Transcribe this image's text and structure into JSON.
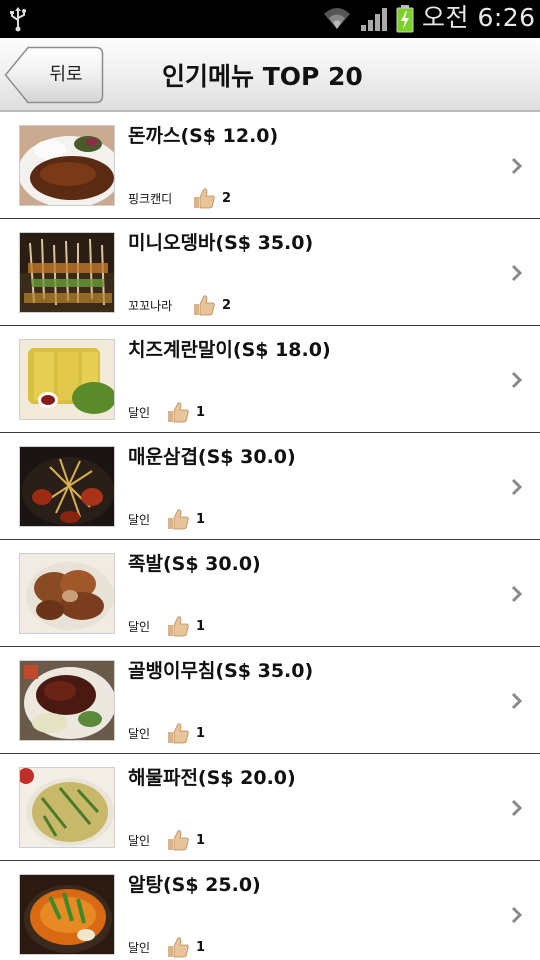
{
  "status_bar": {
    "time": "오전 6:26",
    "icons": [
      "usb-icon",
      "wifi-icon",
      "signal-icon",
      "battery-charging-icon"
    ]
  },
  "header": {
    "back_label": "뒤로",
    "title": "인기메뉴 TOP 20"
  },
  "menu": {
    "items": [
      {
        "title": "돈까스(S$ 12.0)",
        "user": "핑크캔디",
        "likes": "2"
      },
      {
        "title": "미니오뎅바(S$ 35.0)",
        "user": "꼬꼬나라",
        "likes": "2"
      },
      {
        "title": "치즈계란말이(S$ 18.0)",
        "user": "달인",
        "likes": "1"
      },
      {
        "title": "매운삼겹(S$ 30.0)",
        "user": "달인",
        "likes": "1"
      },
      {
        "title": "족발(S$ 30.0)",
        "user": "달인",
        "likes": "1"
      },
      {
        "title": "골뱅이무침(S$ 35.0)",
        "user": "달인",
        "likes": "1"
      },
      {
        "title": "해물파전(S$ 20.0)",
        "user": "달인",
        "likes": "1"
      },
      {
        "title": "알탕(S$ 25.0)",
        "user": "달인",
        "likes": "1"
      }
    ]
  }
}
